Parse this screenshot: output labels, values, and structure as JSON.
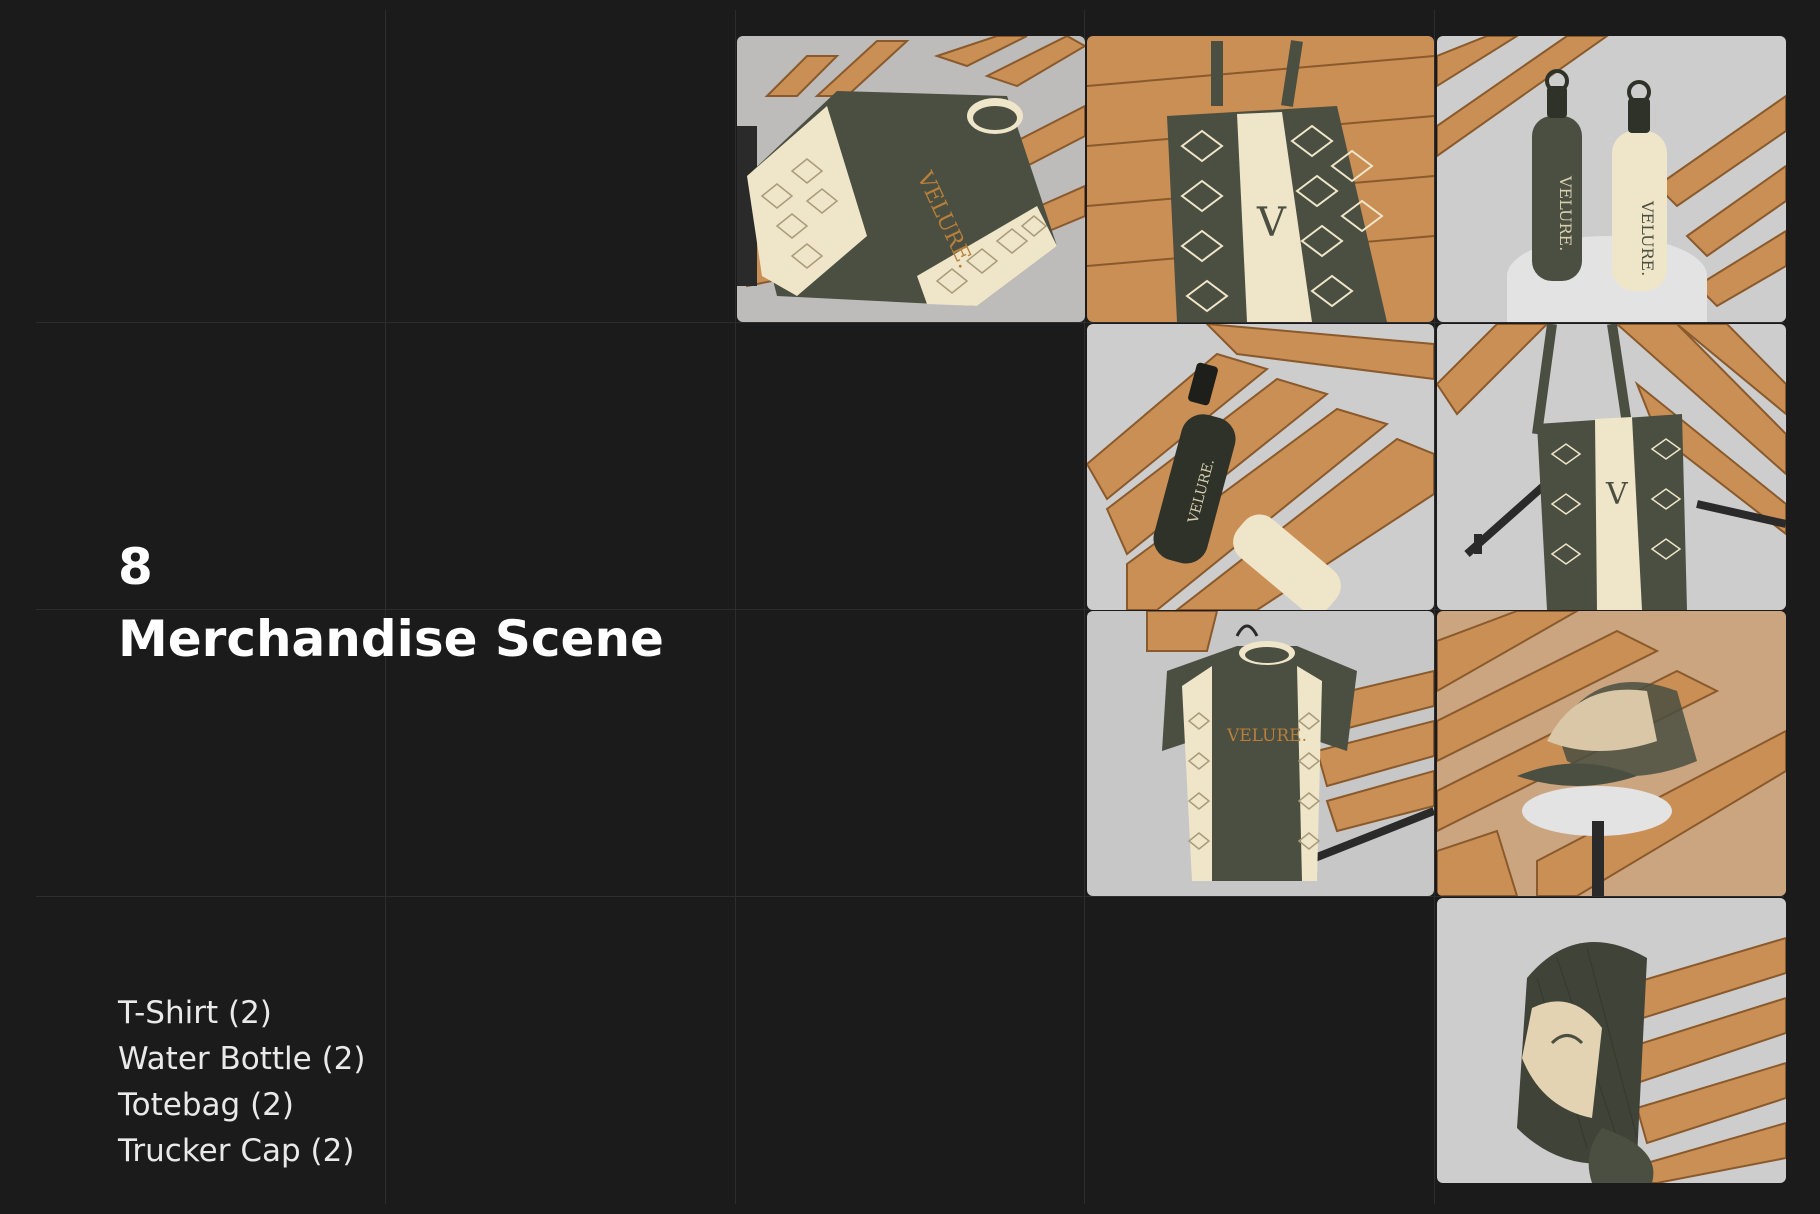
{
  "heading": {
    "count": "8",
    "title": "Merchandise Scene"
  },
  "items": [
    "T-Shirt (2)",
    "Water Bottle (2)",
    "Totebag (2)",
    "Trucker Cap (2)"
  ],
  "brand": {
    "wordmark": "VELURE.",
    "monogram": "V"
  },
  "colors": {
    "background": "#1b1b1b",
    "olive": "#4a4f41",
    "cream": "#efe5c9",
    "wood": "#c98f55",
    "studio_gray": "#cdcdcd",
    "gold": "#b87f3a"
  },
  "mockups": [
    {
      "subject": "T-Shirt flat-lay"
    },
    {
      "subject": "Totebag flat-lay"
    },
    {
      "subject": "Water Bottles standing"
    },
    {
      "subject": "Water Bottles lying"
    },
    {
      "subject": "Totebag hanging"
    },
    {
      "subject": "T-Shirt on hanger"
    },
    {
      "subject": "Trucker Cap on stand"
    },
    {
      "subject": "Trucker Cap hanging"
    }
  ]
}
